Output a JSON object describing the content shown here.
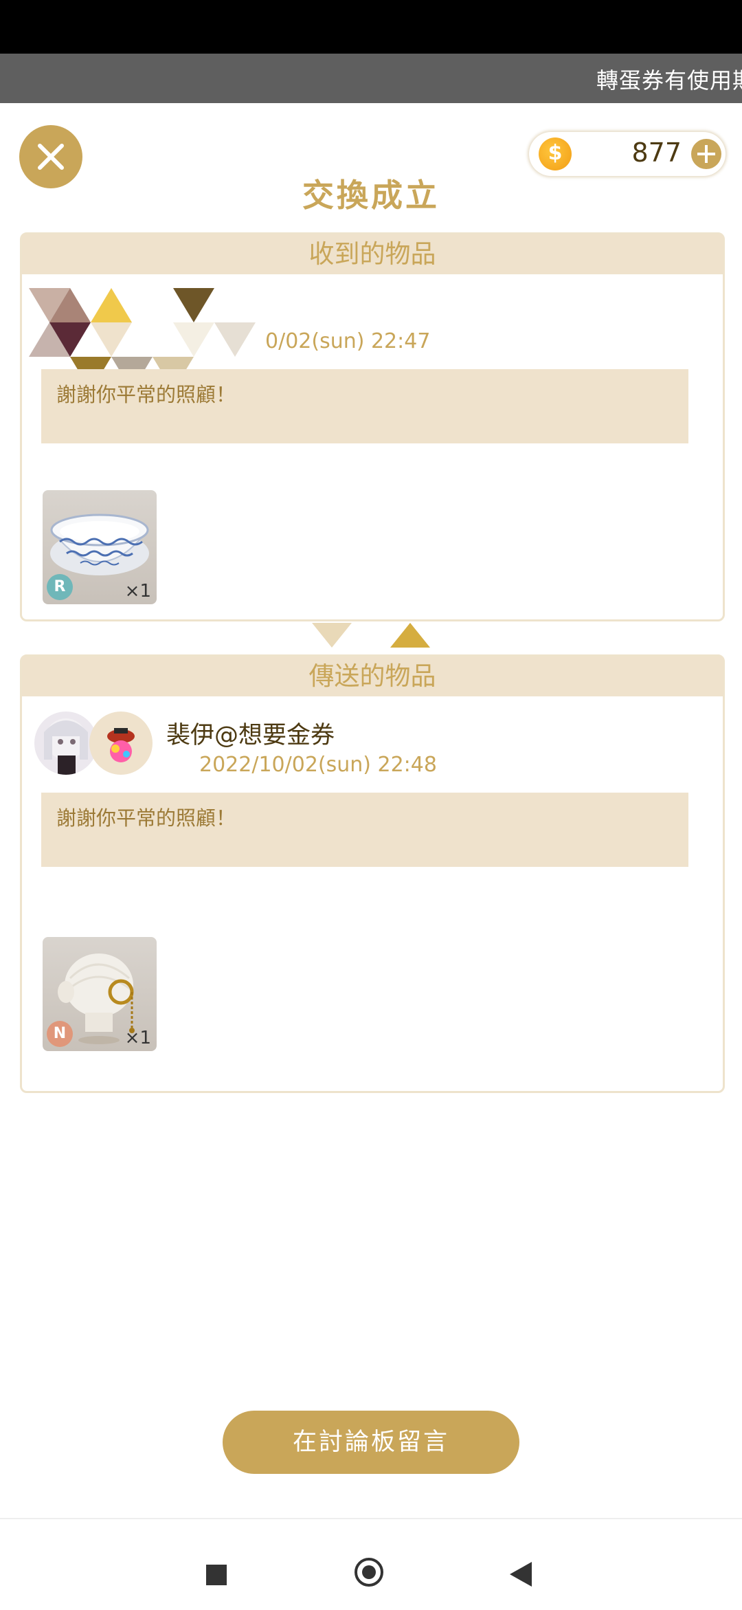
{
  "ticker": {
    "text": "轉蛋券有使用期限"
  },
  "header": {
    "close_icon": "close-icon",
    "coin_icon": "gold-coin-icon",
    "coin_symbol": "$",
    "coin_count": "877",
    "add_icon": "plus-icon",
    "title": "交換成立"
  },
  "received": {
    "header": "收到的物品",
    "date": "0/02(sun) 22:47",
    "message": "謝謝你平常的照顧！",
    "item": {
      "name": "blue-porcelain-bowl",
      "rarity": "R",
      "quantity": "×1"
    }
  },
  "sent": {
    "header": "傳送的物品",
    "username": "裴伊@想要金券",
    "date": "2022/10/02(sun) 22:48",
    "message": "謝謝你平常的照顧！",
    "item": {
      "name": "monocle-accessory",
      "rarity": "N",
      "quantity": "×1"
    }
  },
  "footer": {
    "bbs_button": "在討論板留言"
  },
  "colors": {
    "gold": "#c9a659",
    "beige": "#efe2cc",
    "rarity_r": "#6fb7b9",
    "rarity_n": "#e0977a"
  },
  "navbar": {
    "recent_icon": "recent-apps-icon",
    "home_icon": "home-icon",
    "back_icon": "back-icon"
  }
}
